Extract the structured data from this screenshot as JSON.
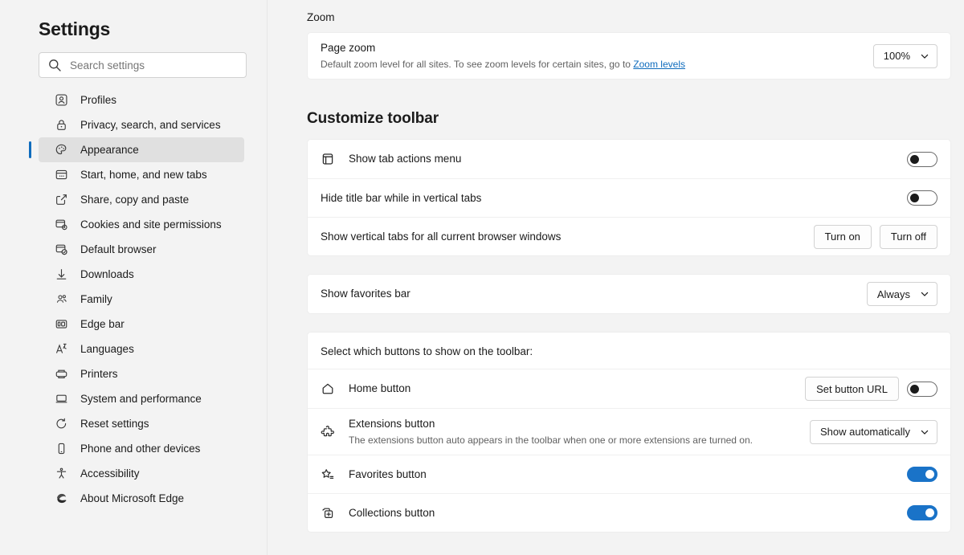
{
  "sidebar": {
    "title": "Settings",
    "search": {
      "placeholder": "Search settings",
      "value": "",
      "icon": "search-icon"
    },
    "items": [
      {
        "label": "Profiles",
        "icon": "profile-icon",
        "active": false
      },
      {
        "label": "Privacy, search, and services",
        "icon": "lock-icon",
        "active": false
      },
      {
        "label": "Appearance",
        "icon": "palette-icon",
        "active": true
      },
      {
        "label": "Start, home, and new tabs",
        "icon": "window-dots-icon",
        "active": false
      },
      {
        "label": "Share, copy and paste",
        "icon": "share-icon",
        "active": false
      },
      {
        "label": "Cookies and site permissions",
        "icon": "site-permissions-icon",
        "active": false
      },
      {
        "label": "Default browser",
        "icon": "default-browser-icon",
        "active": false
      },
      {
        "label": "Downloads",
        "icon": "download-arrow-icon",
        "active": false
      },
      {
        "label": "Family",
        "icon": "family-people-icon",
        "active": false
      },
      {
        "label": "Edge bar",
        "icon": "edge-bar-icon",
        "active": false
      },
      {
        "label": "Languages",
        "icon": "languages-icon",
        "active": false
      },
      {
        "label": "Printers",
        "icon": "printer-icon",
        "active": false
      },
      {
        "label": "System and performance",
        "icon": "laptop-icon",
        "active": false
      },
      {
        "label": "Reset settings",
        "icon": "reset-arrow-icon",
        "active": false
      },
      {
        "label": "Phone and other devices",
        "icon": "phone-icon",
        "active": false
      },
      {
        "label": "Accessibility",
        "icon": "accessibility-icon",
        "active": false
      },
      {
        "label": "About Microsoft Edge",
        "icon": "edge-logo-icon",
        "active": false
      }
    ]
  },
  "zoom_section": {
    "heading": "Zoom",
    "page_zoom": {
      "title": "Page zoom",
      "description_before": "Default zoom level for all sites. To see zoom levels for certain sites, go to ",
      "link_text": "Zoom levels",
      "select_value": "100%"
    }
  },
  "customize_toolbar": {
    "heading": "Customize toolbar",
    "rows": [
      {
        "title": "Show tab actions menu",
        "icon": "tab-actions-icon",
        "control": "toggle",
        "state": "off"
      },
      {
        "title": "Hide title bar while in vertical tabs",
        "icon": null,
        "control": "toggle",
        "state": "off"
      },
      {
        "title": "Show vertical tabs for all current browser windows",
        "icon": null,
        "control": "buttons",
        "buttons": [
          "Turn on",
          "Turn off"
        ]
      }
    ],
    "favorites_bar": {
      "title": "Show favorites bar",
      "select_value": "Always"
    },
    "buttons_group": {
      "label": "Select which buttons to show on the toolbar:",
      "rows": [
        {
          "title": "Home button",
          "icon": "home-icon",
          "control": "button-and-toggle",
          "button_label": "Set button URL",
          "state": "off",
          "sub": null
        },
        {
          "title": "Extensions button",
          "icon": "puzzle-icon",
          "control": "select",
          "select_value": "Show automatically",
          "sub": "The extensions button auto appears in the toolbar when one or more extensions are turned on."
        },
        {
          "title": "Favorites button",
          "icon": "favorites-star-icon",
          "control": "toggle",
          "state": "on",
          "sub": null
        },
        {
          "title": "Collections button",
          "icon": "collections-icon",
          "control": "toggle",
          "state": "on",
          "sub": null
        }
      ]
    }
  },
  "colors": {
    "accent": "#0f6cbd",
    "toggle_on": "#1a73c8",
    "page_bg": "#f3f3f3",
    "card_bg": "#ffffff",
    "active_nav_bg": "#e0e0e0"
  }
}
